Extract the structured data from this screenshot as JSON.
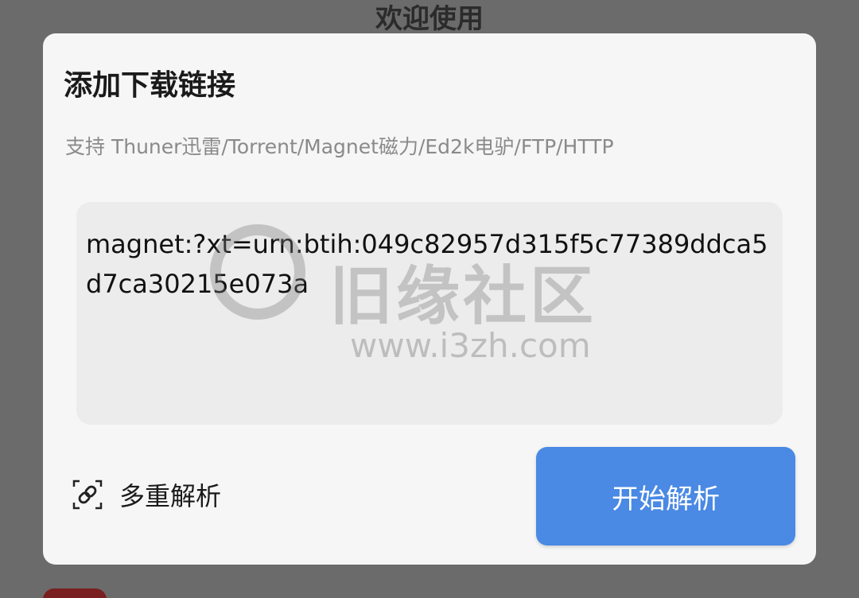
{
  "backdrop": {
    "title": "欢迎使用"
  },
  "dialog": {
    "title": "添加下载链接",
    "subtitle": "支持 Thuner迅雷/Torrent/Magnet磁力/Ed2k电驴/FTP/HTTP",
    "link_input": {
      "value": "magnet:?xt=urn:btih:049c82957d315f5c77389ddca5d7ca30215e073a"
    },
    "multi_parse": {
      "icon": "link-icon",
      "label": "多重解析"
    },
    "parse_button": {
      "label": "开始解析",
      "color": "#4a89e4"
    }
  },
  "watermark": {
    "name": "旧缘社区",
    "url": "www.i3zh.com"
  }
}
